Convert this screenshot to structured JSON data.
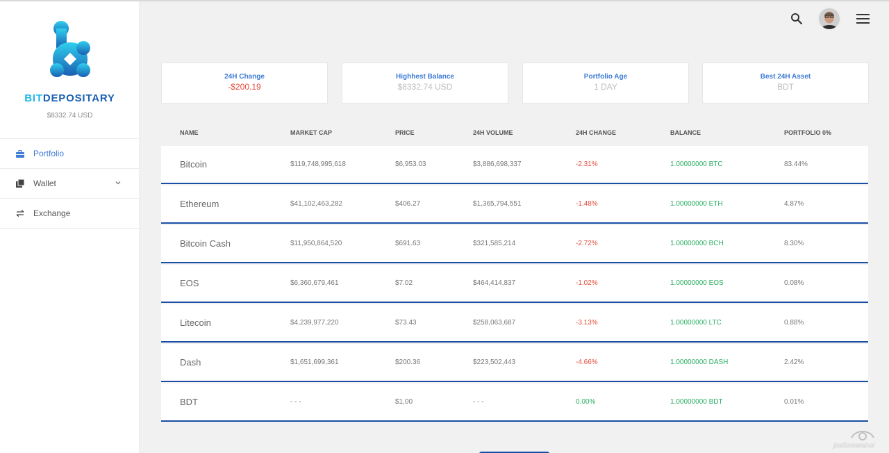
{
  "app": {
    "brand_part1": "BIT",
    "brand_part2": "DEPOSITARY",
    "balance": "$8332.74 USD"
  },
  "nav": [
    {
      "label": "Portfolio",
      "icon": "briefcase-icon",
      "active": true
    },
    {
      "label": "Wallet",
      "icon": "wallet-icon",
      "has_submenu": true
    },
    {
      "label": "Exchange",
      "icon": "exchange-arrows-icon"
    }
  ],
  "header": {
    "search_icon": "search-icon",
    "avatar": "user-avatar",
    "menu_icon": "hamburger-menu-icon"
  },
  "stats": [
    {
      "label": "24H Change",
      "value": "-$200.19",
      "negative": true
    },
    {
      "label": "Highhest Balance",
      "value": "$8332.74 USD"
    },
    {
      "label": "Portfolio Age",
      "value": "1 DAY"
    },
    {
      "label": "Best 24H Asset",
      "value": "BDT"
    }
  ],
  "table": {
    "headers": [
      "NAME",
      "MARKET CAP",
      "PRICE",
      "24H VOLUME",
      "24H CHANGE",
      "BALANCE",
      "PORTFOLIO 0%"
    ],
    "rows": [
      {
        "name": "Bitcoin",
        "market_cap": "$119,748,995,618",
        "price": "$6,953.03",
        "volume": "$3,886,698,337",
        "change": "-2.31%",
        "balance": "1.00000000 BTC",
        "portfolio": "83.44%"
      },
      {
        "name": "Ethereum",
        "market_cap": "$41,102,463,282",
        "price": "$406.27",
        "volume": "$1,365,794,551",
        "change": "-1.48%",
        "balance": "1.00000000 ETH",
        "portfolio": "4.87%"
      },
      {
        "name": "Bitcoin Cash",
        "market_cap": "$11,950,864,520",
        "price": "$691.63",
        "volume": "$321,585,214",
        "change": "-2.72%",
        "balance": "1.00000000 BCH",
        "portfolio": "8.30%"
      },
      {
        "name": "EOS",
        "market_cap": "$6,360,679,461",
        "price": "$7.02",
        "volume": "$464,414,837",
        "change": "-1.02%",
        "balance": "1.00000000 EOS",
        "portfolio": "0.08%"
      },
      {
        "name": "Litecoin",
        "market_cap": "$4,239,977,220",
        "price": "$73.43",
        "volume": "$258,063,687",
        "change": "-3.13%",
        "balance": "1.00000000 LTC",
        "portfolio": "0.88%"
      },
      {
        "name": "Dash",
        "market_cap": "$1,651,699,361",
        "price": "$200.36",
        "volume": "$223,502,443",
        "change": "-4.66%",
        "balance": "1.00000000 DASH",
        "portfolio": "2.42%"
      },
      {
        "name": "BDT",
        "market_cap": "- - -",
        "price": "$1,00",
        "volume": "- - -",
        "change": "0.00%",
        "balance": "1.00000000 BDT",
        "portfolio": "0.01%"
      }
    ]
  },
  "watermark": "joxiScreenshot",
  "colors": {
    "accent": "#3e7bd6",
    "brand_light": "#1eb6e3",
    "brand_dark": "#1b5fb2",
    "negative": "#e74c3c",
    "positive": "#27ae60",
    "row_border": "#1a4fa5"
  }
}
